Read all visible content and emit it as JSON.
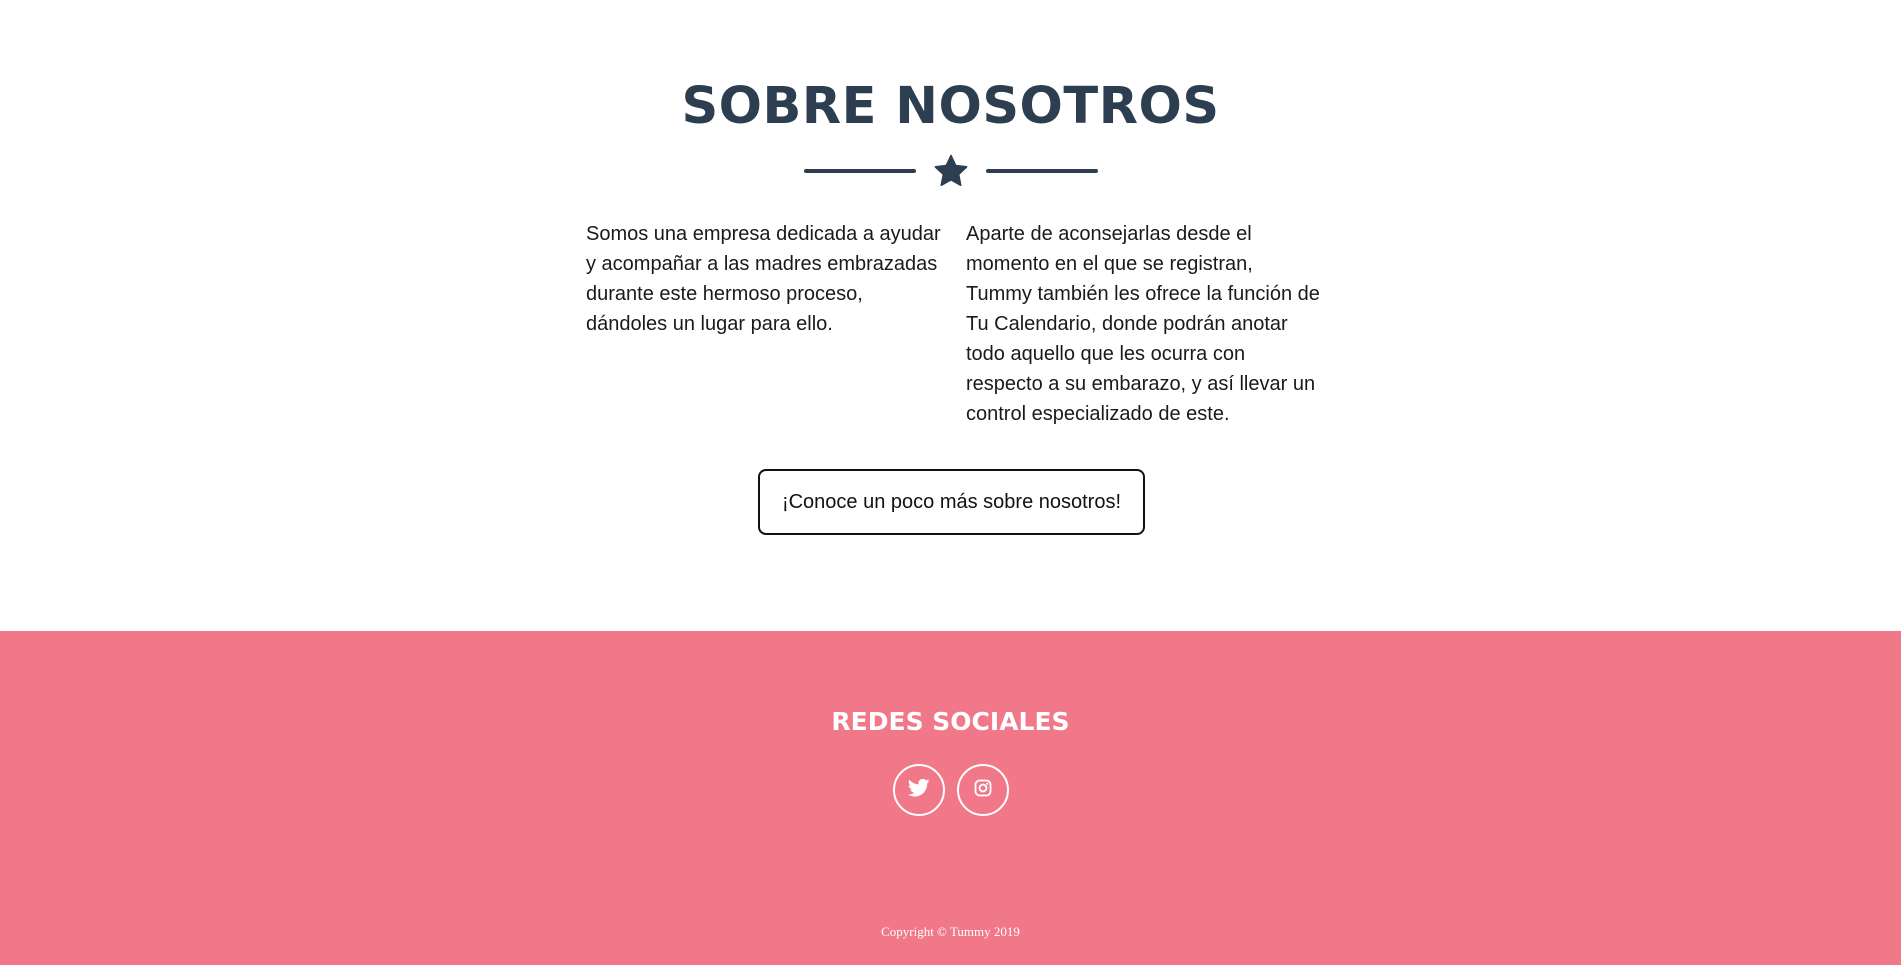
{
  "about": {
    "title": "SOBRE NOSOTROS",
    "divider_icon": "star-icon",
    "col_left": "Somos una empresa dedicada a ayudar y acompañar a las madres embrazadas durante este hermoso proceso, dándoles un lugar para ello.",
    "col_right": "Aparte de aconsejarlas desde el momento en el que se registran, Tummy también les ofrece la función de Tu Calendario, donde podrán anotar todo aquello que les ocurra con respecto a su embarazo, y así llevar un control especializado de este.",
    "button_label": "¡Conoce un poco más sobre nosotros!"
  },
  "footer": {
    "title": "REDES SOCIALES",
    "social": [
      {
        "icon": "twitter-icon"
      },
      {
        "icon": "instagram-icon"
      }
    ],
    "copyright": "Copyright © Tummy 2019"
  },
  "colors": {
    "heading": "#2c3e50",
    "footer_bg": "#f07889",
    "text": "#1a1a1a",
    "white": "#ffffff"
  }
}
